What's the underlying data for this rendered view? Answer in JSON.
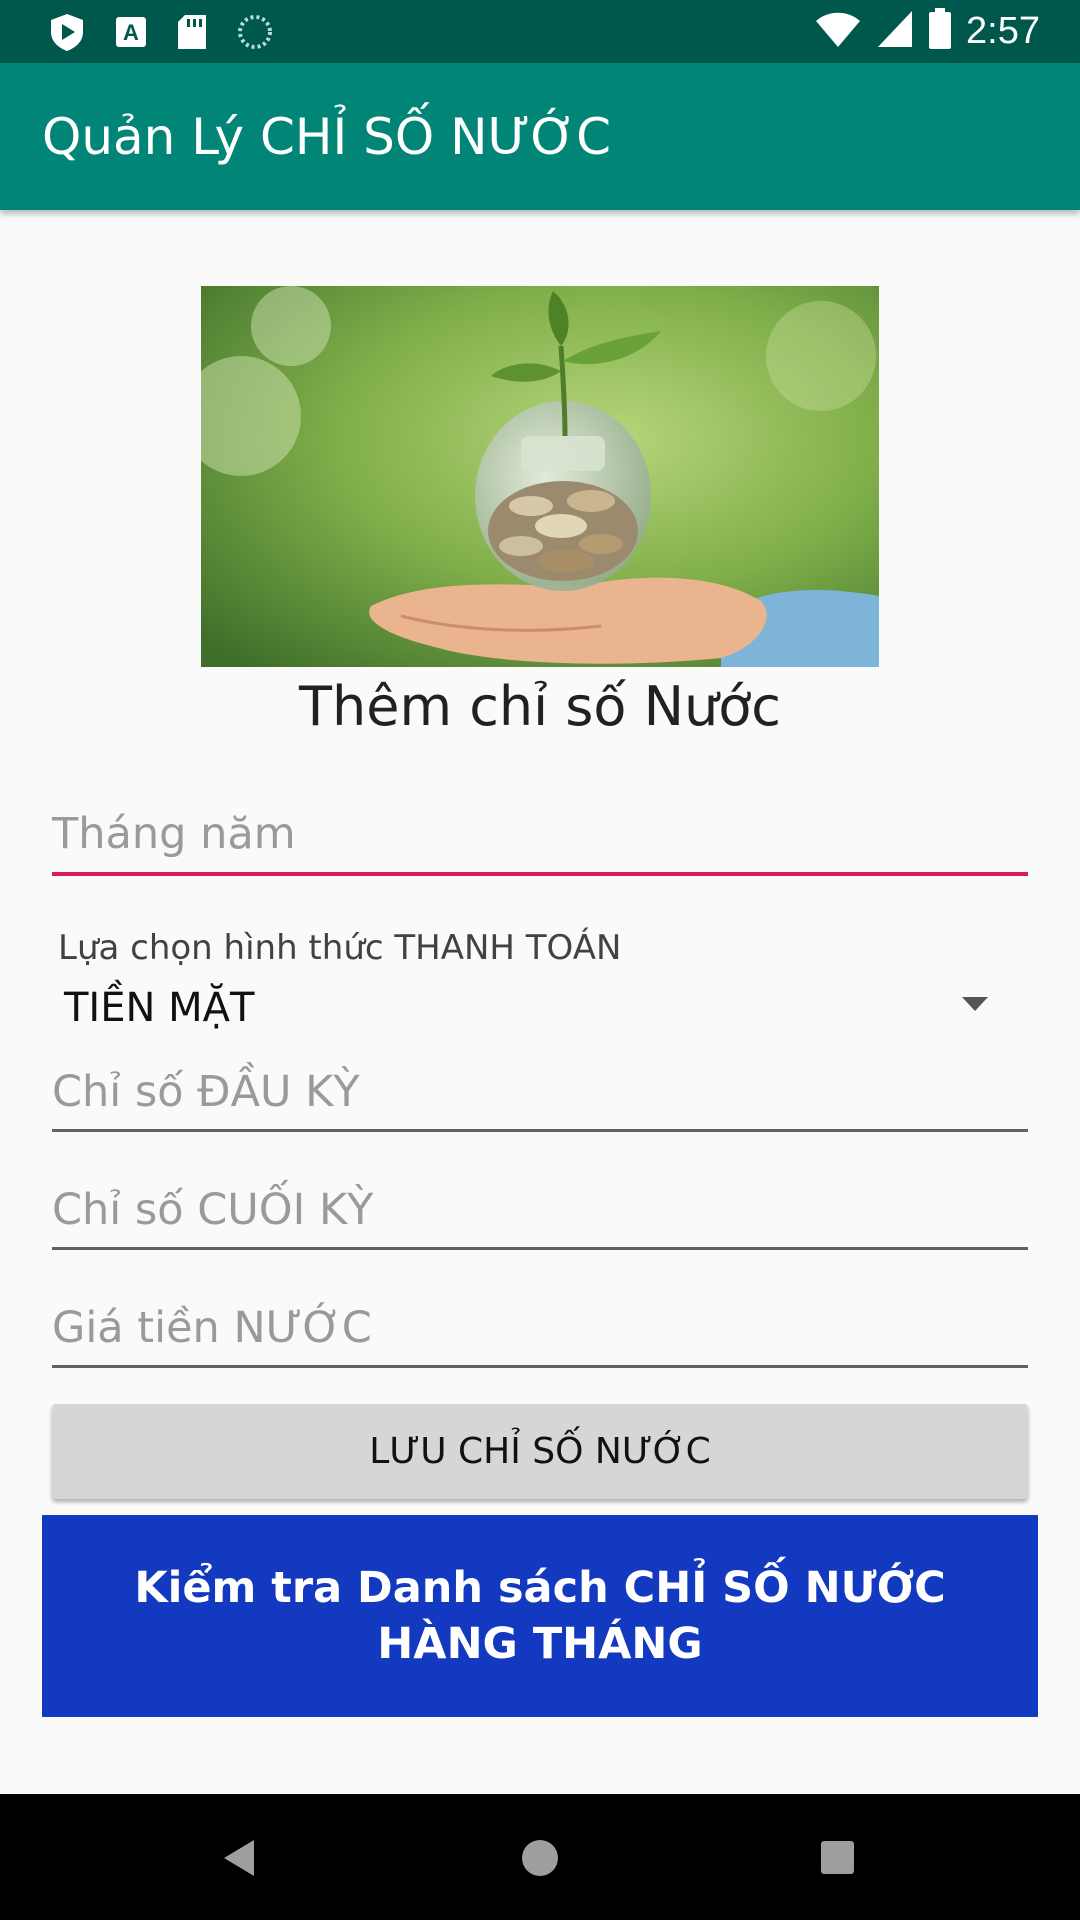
{
  "status_bar": {
    "time": "2:57",
    "icons": [
      "play-protect-icon",
      "font-a-icon",
      "sd-card-icon",
      "loading-icon",
      "wifi-icon",
      "signal-icon",
      "battery-icon"
    ]
  },
  "app_bar": {
    "title": "Quản Lý CHỈ SỐ NƯỚC"
  },
  "form": {
    "heading": "Thêm chỉ số Nước",
    "month_year_placeholder": "Tháng năm",
    "payment_caption": "Lựa chọn hình thức THANH TOÁN",
    "payment_selected": "TIỀN MẶT",
    "start_index_placeholder": "Chỉ số ĐẦU KỲ",
    "end_index_placeholder": "Chỉ số CUỐI KỲ",
    "price_placeholder": "Giá tiền NƯỚC",
    "save_button": "LƯU CHỈ SỐ NƯỚC",
    "list_button": "Kiểm tra Danh sách CHỈ SỐ NƯỚC HÀNG THÁNG"
  },
  "colors": {
    "status_bar": "#00574b",
    "app_bar": "#008577",
    "focused_underline": "#d81b60",
    "list_button": "#1239bf"
  }
}
